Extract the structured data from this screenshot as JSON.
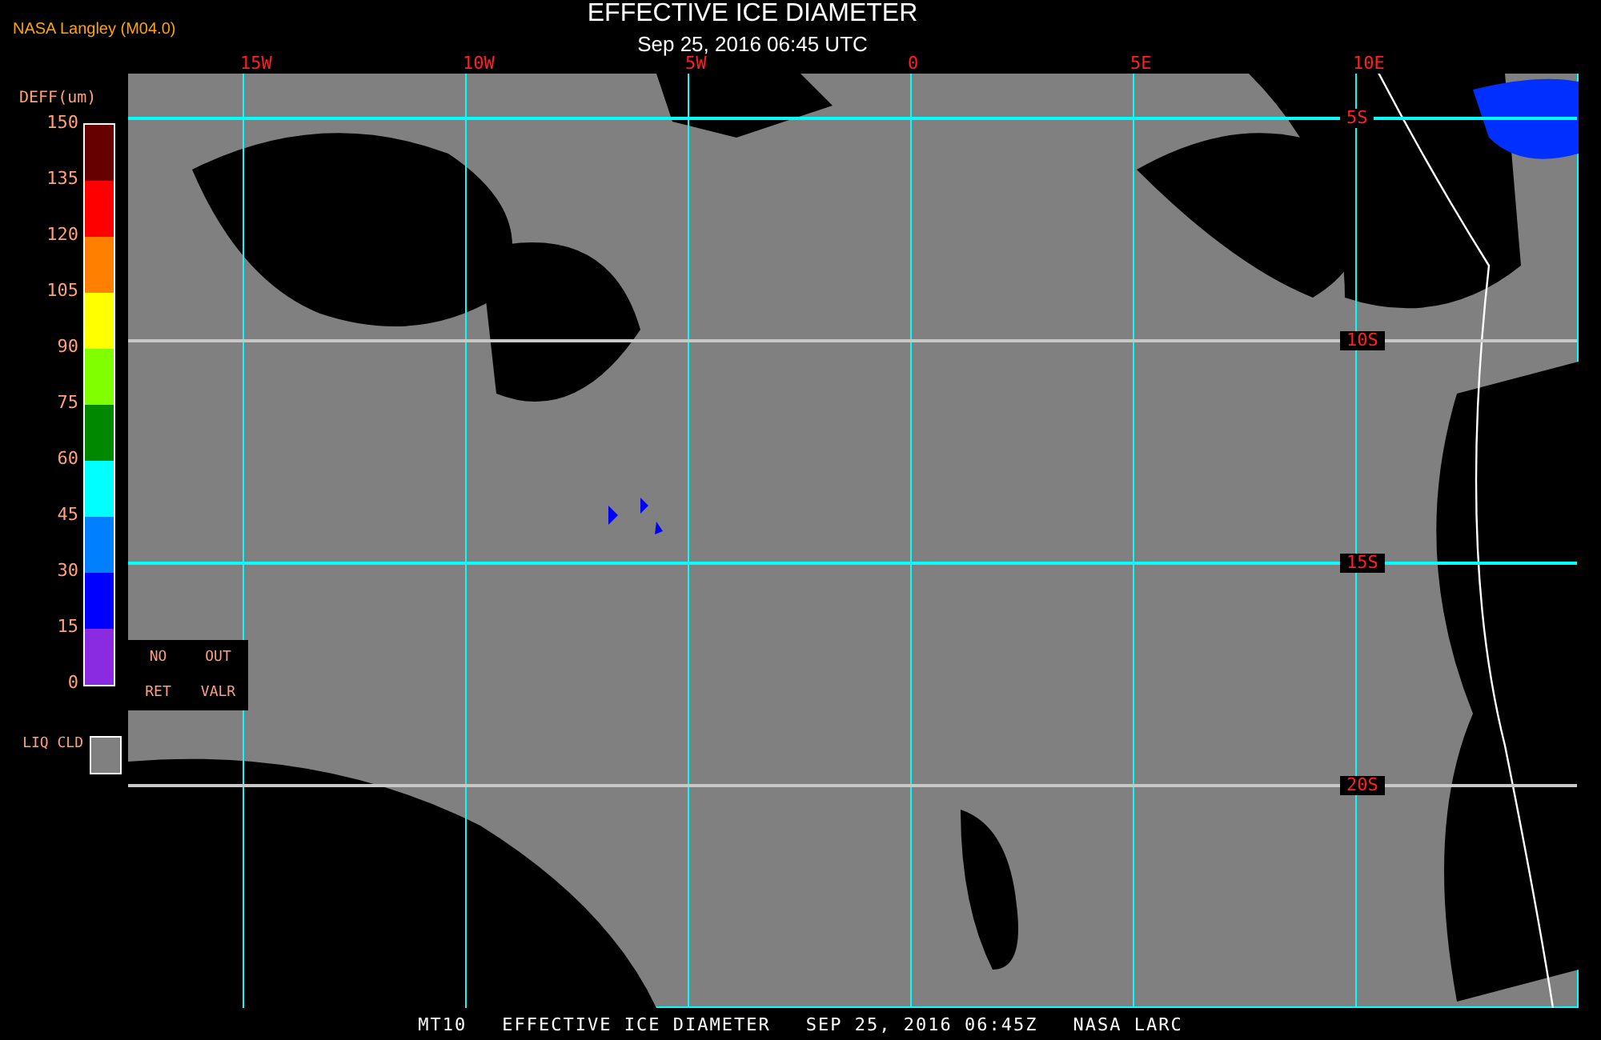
{
  "credit": "NASA Langley (M04.0)",
  "title": "EFFECTIVE ICE DIAMETER",
  "subtitle": "Sep 25, 2016 06:45 UTC",
  "longitudes": [
    {
      "label": "15W"
    },
    {
      "label": "10W"
    },
    {
      "label": "5W"
    },
    {
      "label": "0"
    },
    {
      "label": "5E"
    },
    {
      "label": "10E"
    }
  ],
  "latitudes": [
    {
      "label": "5S",
      "color": "#00ffff"
    },
    {
      "label": "10S",
      "color": "#c8c8c8"
    },
    {
      "label": "15S",
      "color": "#00ffff"
    },
    {
      "label": "20S",
      "color": "#c8c8c8"
    }
  ],
  "legend": {
    "title": "DEFF(um)",
    "ticks": [
      "150",
      "135",
      "120",
      "105",
      "90",
      "75",
      "60",
      "45",
      "30",
      "15",
      "0"
    ],
    "segments": [
      {
        "color": "#660000"
      },
      {
        "color": "#ff0000"
      },
      {
        "color": "#ff8000"
      },
      {
        "color": "#ffff00"
      },
      {
        "color": "#80ff00"
      },
      {
        "color": "#008800"
      },
      {
        "color": "#00ffff"
      },
      {
        "color": "#0080ff"
      },
      {
        "color": "#0000ff"
      },
      {
        "color": "#8a2be2"
      }
    ],
    "no_retrieval": [
      "NO",
      "RET"
    ],
    "out_of_range": [
      "OUT",
      "VALR"
    ],
    "liquid_cloud": [
      "LIQ",
      "CLD"
    ]
  },
  "footer": [
    "MT10",
    "EFFECTIVE ICE DIAMETER",
    "SEP 25, 2016 06:45Z",
    "NASA LARC"
  ]
}
